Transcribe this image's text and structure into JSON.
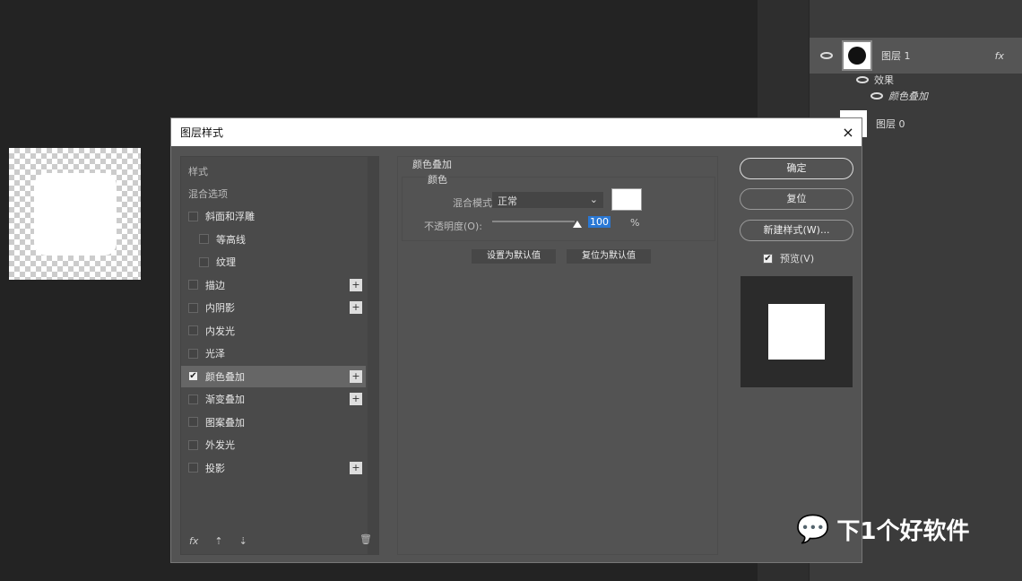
{
  "dialog": {
    "title": "图层样式",
    "close": "×"
  },
  "styles": {
    "header": "样式",
    "blend": "混合选项",
    "items": [
      {
        "label": "斜面和浮雕",
        "checked": false,
        "plus": false,
        "indent": false
      },
      {
        "label": "等高线",
        "checked": false,
        "plus": false,
        "indent": true
      },
      {
        "label": "纹理",
        "checked": false,
        "plus": false,
        "indent": true
      },
      {
        "label": "描边",
        "checked": false,
        "plus": true,
        "indent": false
      },
      {
        "label": "内阴影",
        "checked": false,
        "plus": true,
        "indent": false
      },
      {
        "label": "内发光",
        "checked": false,
        "plus": false,
        "indent": false
      },
      {
        "label": "光泽",
        "checked": false,
        "plus": false,
        "indent": false
      },
      {
        "label": "颜色叠加",
        "checked": true,
        "plus": true,
        "indent": false
      },
      {
        "label": "渐变叠加",
        "checked": false,
        "plus": true,
        "indent": false
      },
      {
        "label": "图案叠加",
        "checked": false,
        "plus": false,
        "indent": false
      },
      {
        "label": "外发光",
        "checked": false,
        "plus": false,
        "indent": false
      },
      {
        "label": "投影",
        "checked": false,
        "plus": true,
        "indent": false
      }
    ],
    "fx": "fx"
  },
  "overlay": {
    "title": "颜色叠加",
    "group": "颜色",
    "blend_label": "混合模式:",
    "blend_value": "正常",
    "color": "#ffffff",
    "opacity_label": "不透明度(O):",
    "opacity": "100",
    "opacity_unit": "%",
    "set_default": "设置为默认值",
    "reset_default": "复位为默认值"
  },
  "buttons": {
    "ok": "确定",
    "reset": "复位",
    "new_style": "新建样式(W)...",
    "preview": "预览(V)"
  },
  "layers": {
    "layer1": "图层 1",
    "effects": "效果",
    "effect_item": "颜色叠加",
    "layer0": "图层 0",
    "fx": "fx"
  },
  "watermark": "下1个好软件"
}
